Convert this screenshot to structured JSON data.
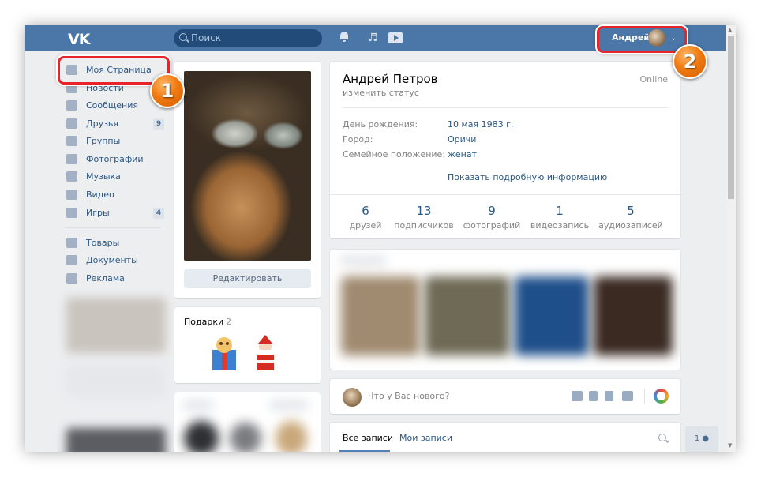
{
  "header": {
    "logo": "VK",
    "search_placeholder": "Поиск",
    "user_name": "Андрей",
    "icons": [
      "bell-icon",
      "music-icon",
      "video-icon",
      "chevron-down-icon"
    ]
  },
  "sidebar": {
    "items": [
      {
        "label": "Моя Страница",
        "icon": "home-icon",
        "count": ""
      },
      {
        "label": "Новости",
        "icon": "news-icon",
        "count": ""
      },
      {
        "label": "Сообщения",
        "icon": "messages-icon",
        "count": ""
      },
      {
        "label": "Друзья",
        "icon": "friends-icon",
        "count": "9"
      },
      {
        "label": "Группы",
        "icon": "groups-icon",
        "count": ""
      },
      {
        "label": "Фотографии",
        "icon": "camera-icon",
        "count": ""
      },
      {
        "label": "Музыка",
        "icon": "music-icon",
        "count": ""
      },
      {
        "label": "Видео",
        "icon": "film-icon",
        "count": ""
      },
      {
        "label": "Игры",
        "icon": "gamepad-icon",
        "count": "4"
      },
      {
        "label": "Товары",
        "icon": "bag-icon",
        "count": ""
      },
      {
        "label": "Документы",
        "icon": "document-icon",
        "count": ""
      },
      {
        "label": "Реклама",
        "icon": "megaphone-icon",
        "count": ""
      }
    ]
  },
  "profile": {
    "edit_button": "Редактировать",
    "gifts_title": "Подарки",
    "gifts_count": "2",
    "name": "Андрей Петров",
    "status": "изменить статус",
    "online": "Online",
    "info": [
      {
        "label": "День рождения:",
        "value": "10 мая 1983 г."
      },
      {
        "label": "Город:",
        "value": "Оричи"
      },
      {
        "label": "Семейное положение:",
        "value": "женат"
      }
    ],
    "show_more": "Показать подробную информацию",
    "counters": [
      {
        "num": "6",
        "label": "друзей"
      },
      {
        "num": "13",
        "label": "подписчиков"
      },
      {
        "num": "9",
        "label": "фотографий"
      },
      {
        "num": "1",
        "label": "видеозапись"
      },
      {
        "num": "5",
        "label": "аудиозаписей"
      }
    ]
  },
  "composer": {
    "placeholder": "Что у Вас нового?",
    "icons": [
      "camera-icon",
      "film-icon",
      "music-icon",
      "text-icon",
      "palette-icon"
    ]
  },
  "wall": {
    "tab_all": "Все записи",
    "tab_mine": "Мои записи"
  },
  "friends_widget": "1",
  "callouts": {
    "first": "1",
    "second": "2"
  },
  "colors": {
    "brand": "#4a76a8",
    "link": "#2a5885",
    "highlight": "#e8242a",
    "callout": "#f07a10"
  }
}
